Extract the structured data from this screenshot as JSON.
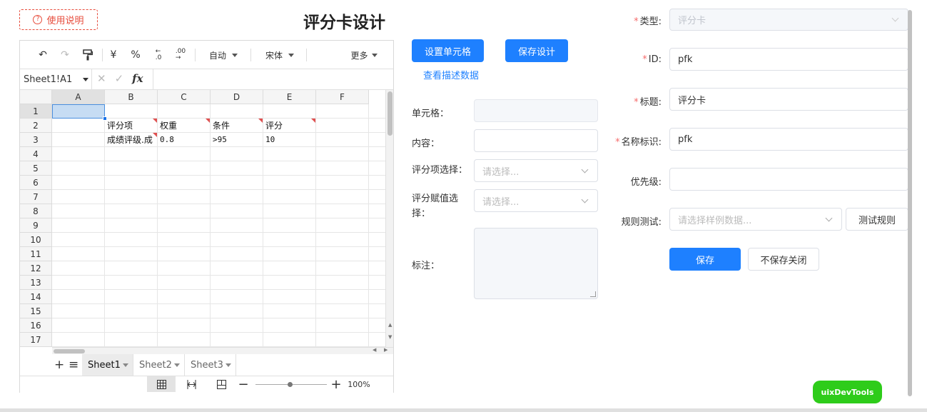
{
  "header": {
    "help_icon": "question-circle-icon",
    "help_label": "使用说明",
    "title": "评分卡设计"
  },
  "sheet": {
    "toolbar": {
      "undo_icon": "↶",
      "redo_icon": "↷",
      "format_painter_icon": "paint-format-icon",
      "currency": "¥",
      "percent": "%",
      "decimal_add": ".0",
      "decimal_sub": ".00",
      "format": "自动",
      "font": "宋体",
      "more": "更多"
    },
    "formula": {
      "name_box": "Sheet1!A1",
      "cancel_icon": "✕",
      "confirm_icon": "✓",
      "fx": "fx"
    },
    "columns": [
      "A",
      "B",
      "C",
      "D",
      "E",
      "F"
    ],
    "rows": [
      "1",
      "2",
      "3",
      "4",
      "5",
      "6",
      "7",
      "8",
      "9",
      "10",
      "11",
      "12",
      "13",
      "14",
      "15",
      "16",
      "17"
    ],
    "cells": {
      "B2": "评分项",
      "C2": "权重",
      "D2": "条件",
      "E2": "评分",
      "B3": "成绩评级.成",
      "C3": "0.8",
      "D3": ">95",
      "E3": "10"
    },
    "tabs": [
      "Sheet1",
      "Sheet2",
      "Sheet3"
    ],
    "active_tab": "Sheet1",
    "zoom": "100%"
  },
  "middle": {
    "set_cell_button": "设置单元格",
    "save_design_button": "保存设计",
    "view_desc_link": "查看描述数据",
    "cell_label": "单元格：",
    "content_label": "内容：",
    "item_select_label": "评分项选择：",
    "item_select_placeholder": "请选择...",
    "value_select_label": "评分赋值选择：",
    "value_select_placeholder": "请选择...",
    "note_label": "标注："
  },
  "right": {
    "type_label": "类型:",
    "type_value": "评分卡",
    "id_label": "ID:",
    "id_value": "pfk",
    "title_label": "标题:",
    "title_value": "评分卡",
    "name_label": "名称标识:",
    "name_value": "pfk",
    "priority_label": "优先级:",
    "priority_value": "",
    "rule_test_label": "规则测试:",
    "rule_test_placeholder": "请选择样例数据...",
    "test_rule_button": "测试规则",
    "save_button": "保存",
    "close_button": "不保存关闭"
  },
  "dev_badge": "uixDevTools",
  "colors": {
    "primary": "#1e80ff",
    "danger": "#e74c3c",
    "required": "#f56c6c",
    "badge": "#2ecc1a"
  }
}
